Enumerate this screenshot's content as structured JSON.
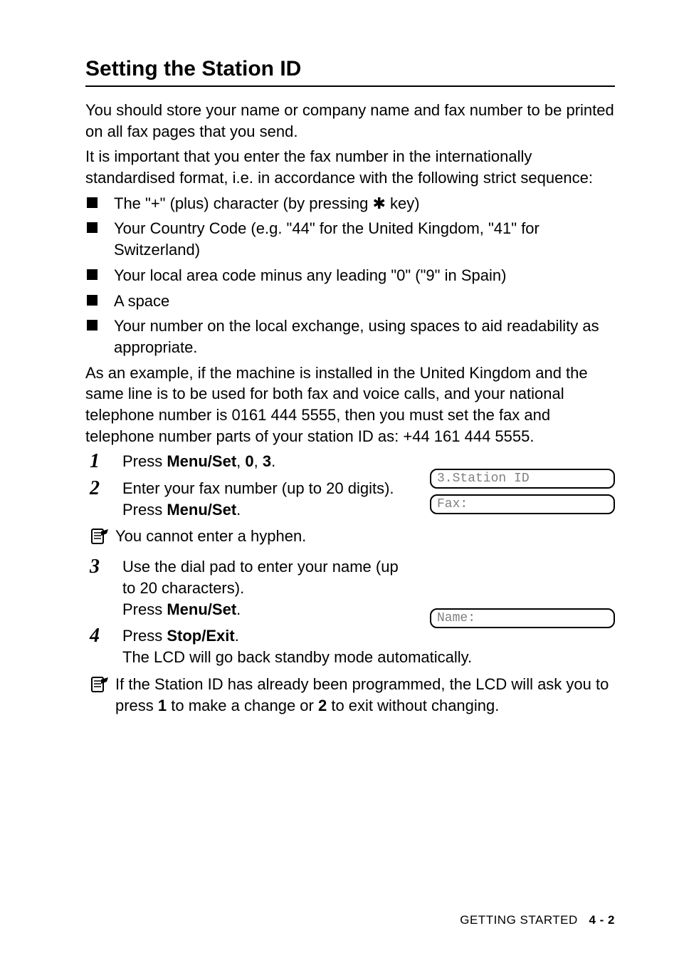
{
  "title": "Setting the Station ID",
  "intro1": "You should store your name or company name and fax number to be printed on all fax pages that you send.",
  "intro2": "It is important that you enter the fax number in the internationally standardised format, i.e. in accordance with the following strict sequence:",
  "bullets": {
    "b1a": "The \"+\" (plus) character (by pressing ",
    "b1b": " key)",
    "b2": "Your Country Code (e.g. \"44\" for the United Kingdom, \"41\" for Switzerland)",
    "b3": "Your local area code minus any leading \"0\" (\"9\" in Spain)",
    "b4": "A space",
    "b5": "Your number on the local exchange, using spaces to aid readability as appropriate."
  },
  "example": "As an example, if the machine is installed in the United Kingdom and the same line is to be used for both fax and voice calls, and your national telephone number is 0161 444 5555, then you must set the fax and telephone number parts of your station ID as: +44 161 444 5555.",
  "steps": {
    "s1a": "Press ",
    "s1b": "Menu/Set",
    "s1c": ", ",
    "s1d": "0",
    "s1e": ", ",
    "s1f": "3",
    "s1g": ".",
    "s2a": "Enter your fax number (up to 20 digits).",
    "s2b": "Press ",
    "s2c": "Menu/Set",
    "s2d": ".",
    "s3a": "Use the dial pad to enter your name (up to 20 characters).",
    "s3b": "Press ",
    "s3c": "Menu/Set",
    "s3d": ".",
    "s4a": "Press ",
    "s4b": "Stop/Exit",
    "s4c": ".",
    "s4d": "The LCD will go back standby mode automatically."
  },
  "note1": "You cannot enter a hyphen.",
  "note2a": "If the Station ID has already been programmed, the LCD will ask you to press ",
  "note2b": "1",
  "note2c": " to make a change or ",
  "note2d": "2",
  "note2e": " to exit without changing.",
  "lcd1": "3.Station ID",
  "lcd2": "Fax:",
  "lcd3": "Name:",
  "footer_label": "GETTING STARTED",
  "footer_page": "4 - 2"
}
